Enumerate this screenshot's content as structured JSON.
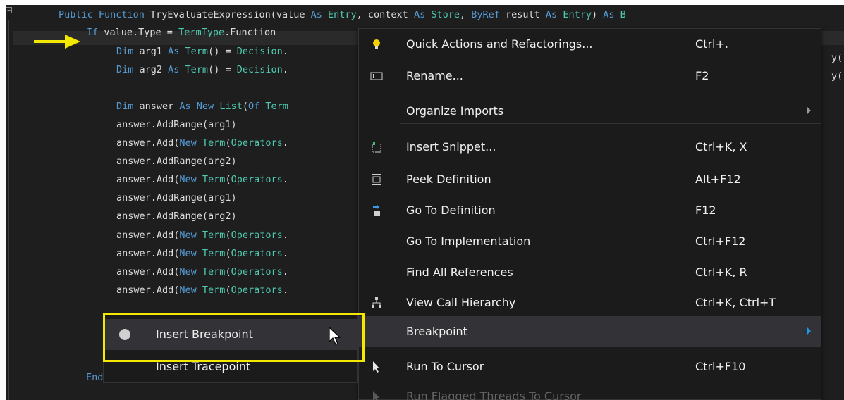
{
  "editor": {
    "lines": [
      [
        {
          "c": "kw",
          "t": "Public Function "
        },
        {
          "c": "pl",
          "t": "TryEvaluateExpression(value "
        },
        {
          "c": "kw",
          "t": "As "
        },
        {
          "c": "ty",
          "t": "Entry"
        },
        {
          "c": "pl",
          "t": ", context "
        },
        {
          "c": "kw",
          "t": "As "
        },
        {
          "c": "ty",
          "t": "Store"
        },
        {
          "c": "pl",
          "t": ", "
        },
        {
          "c": "kw",
          "t": "ByRef "
        },
        {
          "c": "pl",
          "t": "result "
        },
        {
          "c": "kw",
          "t": "As "
        },
        {
          "c": "ty",
          "t": "Entry"
        },
        {
          "c": "pl",
          "t": ") "
        },
        {
          "c": "kw",
          "t": "As "
        },
        {
          "c": "ty",
          "t": "B"
        }
      ],
      [
        {
          "c": "kw",
          "t": "If "
        },
        {
          "c": "pl",
          "t": "value.Type = "
        },
        {
          "c": "ty",
          "t": "TermType"
        },
        {
          "c": "pl",
          "t": ".Function"
        }
      ],
      [
        {
          "c": "kw",
          "t": "Dim "
        },
        {
          "c": "pl",
          "t": "arg1 "
        },
        {
          "c": "kw",
          "t": "As "
        },
        {
          "c": "ty",
          "t": "Term"
        },
        {
          "c": "pl",
          "t": "() = "
        },
        {
          "c": "ty",
          "t": "Decision"
        },
        {
          "c": "pl",
          "t": "."
        }
      ],
      [
        {
          "c": "kw",
          "t": "Dim "
        },
        {
          "c": "pl",
          "t": "arg2 "
        },
        {
          "c": "kw",
          "t": "As "
        },
        {
          "c": "ty",
          "t": "Term"
        },
        {
          "c": "pl",
          "t": "() = "
        },
        {
          "c": "ty",
          "t": "Decision"
        },
        {
          "c": "pl",
          "t": "."
        }
      ],
      [],
      [
        {
          "c": "kw",
          "t": "Dim "
        },
        {
          "c": "pl",
          "t": "answer "
        },
        {
          "c": "kw",
          "t": "As New "
        },
        {
          "c": "ty",
          "t": "List"
        },
        {
          "c": "pl",
          "t": "("
        },
        {
          "c": "kw",
          "t": "Of "
        },
        {
          "c": "ty",
          "t": "Term"
        }
      ],
      [
        {
          "c": "pl",
          "t": "answer.AddRange(arg1)"
        }
      ],
      [
        {
          "c": "pl",
          "t": "answer.Add("
        },
        {
          "c": "kw",
          "t": "New "
        },
        {
          "c": "ty",
          "t": "Term"
        },
        {
          "c": "pl",
          "t": "("
        },
        {
          "c": "ty",
          "t": "Operators"
        },
        {
          "c": "pl",
          "t": "."
        }
      ],
      [
        {
          "c": "pl",
          "t": "answer.AddRange(arg2)"
        }
      ],
      [
        {
          "c": "pl",
          "t": "answer.Add("
        },
        {
          "c": "kw",
          "t": "New "
        },
        {
          "c": "ty",
          "t": "Term"
        },
        {
          "c": "pl",
          "t": "("
        },
        {
          "c": "ty",
          "t": "Operators"
        },
        {
          "c": "pl",
          "t": "."
        }
      ],
      [
        {
          "c": "pl",
          "t": "answer.AddRange(arg1)"
        }
      ],
      [
        {
          "c": "pl",
          "t": "answer.AddRange(arg2)"
        }
      ],
      [
        {
          "c": "pl",
          "t": "answer.Add("
        },
        {
          "c": "kw",
          "t": "New "
        },
        {
          "c": "ty",
          "t": "Term"
        },
        {
          "c": "pl",
          "t": "("
        },
        {
          "c": "ty",
          "t": "Operators"
        },
        {
          "c": "pl",
          "t": "."
        }
      ],
      [
        {
          "c": "pl",
          "t": "answer.Add("
        },
        {
          "c": "kw",
          "t": "New "
        },
        {
          "c": "ty",
          "t": "Term"
        },
        {
          "c": "pl",
          "t": "("
        },
        {
          "c": "ty",
          "t": "Operators"
        },
        {
          "c": "pl",
          "t": "."
        }
      ],
      [
        {
          "c": "pl",
          "t": "answer.Add("
        },
        {
          "c": "kw",
          "t": "New "
        },
        {
          "c": "ty",
          "t": "Term"
        },
        {
          "c": "pl",
          "t": "("
        },
        {
          "c": "ty",
          "t": "Operators"
        },
        {
          "c": "pl",
          "t": "."
        }
      ],
      [
        {
          "c": "pl",
          "t": "answer.Add("
        },
        {
          "c": "kw",
          "t": "New "
        },
        {
          "c": "ty",
          "t": "Term"
        },
        {
          "c": "pl",
          "t": "("
        },
        {
          "c": "ty",
          "t": "Operators"
        },
        {
          "c": "pl",
          "t": "."
        }
      ]
    ],
    "right_fragment_1": "y(",
    "right_fragment_2": "y(",
    "end_fragment": "End"
  },
  "context_menu": {
    "items": [
      {
        "label": "Quick Actions and Refactorings...",
        "shortcut": "Ctrl+.",
        "icon": "lightbulb-icon"
      },
      {
        "label": "Rename...",
        "shortcut": "F2",
        "icon": "rename-icon"
      },
      {
        "label": "Organize Imports",
        "shortcut": "",
        "icon": "",
        "submenu": true
      },
      {
        "label": "Insert Snippet...",
        "shortcut": "Ctrl+K, X",
        "icon": "insert-snippet-icon"
      },
      {
        "label": "Peek Definition",
        "shortcut": "Alt+F12",
        "icon": "peek-definition-icon"
      },
      {
        "label": "Go To Definition",
        "shortcut": "F12",
        "icon": "go-to-definition-icon"
      },
      {
        "label": "Go To Implementation",
        "shortcut": "Ctrl+F12",
        "icon": ""
      },
      {
        "label": "Find All References",
        "shortcut": "Ctrl+K, R",
        "icon": ""
      },
      {
        "label": "View Call Hierarchy",
        "shortcut": "Ctrl+K, Ctrl+T",
        "icon": "call-hierarchy-icon"
      },
      {
        "label": "Breakpoint",
        "shortcut": "",
        "icon": "",
        "submenu": true,
        "selected": true
      },
      {
        "label": "Run To Cursor",
        "shortcut": "Ctrl+F10",
        "icon": "run-to-cursor-icon"
      },
      {
        "label": "Run Flagged Threads To Cursor",
        "shortcut": "",
        "icon": "run-flagged-threads-icon",
        "disabled": true
      }
    ]
  },
  "breakpoint_submenu": {
    "items": [
      {
        "label": "Insert Breakpoint",
        "selected": true
      },
      {
        "label": "Insert Tracepoint"
      }
    ]
  },
  "colors": {
    "editor_bg": "#1e1e1e",
    "keyword": "#569cd6",
    "type": "#4ec9b0",
    "highlight_box": "#f4e800",
    "exec_arrow": "#f4e800"
  }
}
